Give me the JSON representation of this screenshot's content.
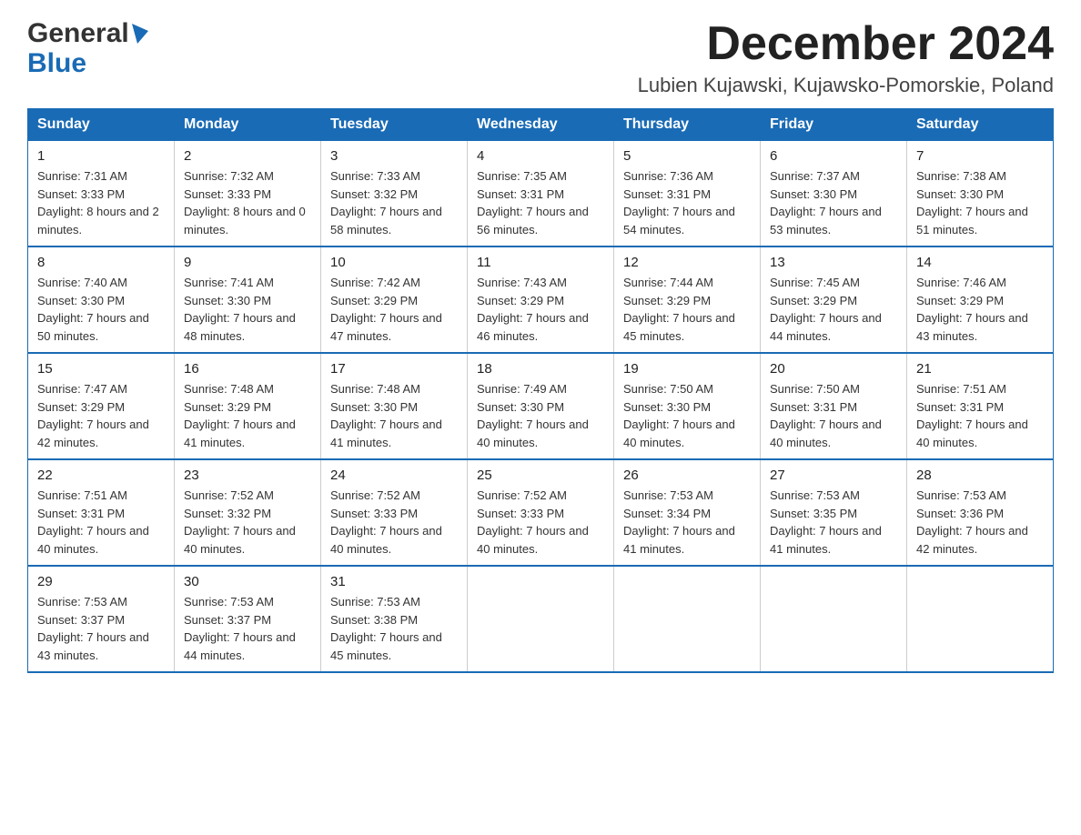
{
  "header": {
    "logo_general": "General",
    "logo_blue": "Blue",
    "month_title": "December 2024",
    "location": "Lubien Kujawski, Kujawsko-Pomorskie, Poland"
  },
  "weekdays": [
    "Sunday",
    "Monday",
    "Tuesday",
    "Wednesday",
    "Thursday",
    "Friday",
    "Saturday"
  ],
  "weeks": [
    [
      {
        "day": "1",
        "sunrise": "7:31 AM",
        "sunset": "3:33 PM",
        "daylight": "8 hours and 2 minutes."
      },
      {
        "day": "2",
        "sunrise": "7:32 AM",
        "sunset": "3:33 PM",
        "daylight": "8 hours and 0 minutes."
      },
      {
        "day": "3",
        "sunrise": "7:33 AM",
        "sunset": "3:32 PM",
        "daylight": "7 hours and 58 minutes."
      },
      {
        "day": "4",
        "sunrise": "7:35 AM",
        "sunset": "3:31 PM",
        "daylight": "7 hours and 56 minutes."
      },
      {
        "day": "5",
        "sunrise": "7:36 AM",
        "sunset": "3:31 PM",
        "daylight": "7 hours and 54 minutes."
      },
      {
        "day": "6",
        "sunrise": "7:37 AM",
        "sunset": "3:30 PM",
        "daylight": "7 hours and 53 minutes."
      },
      {
        "day": "7",
        "sunrise": "7:38 AM",
        "sunset": "3:30 PM",
        "daylight": "7 hours and 51 minutes."
      }
    ],
    [
      {
        "day": "8",
        "sunrise": "7:40 AM",
        "sunset": "3:30 PM",
        "daylight": "7 hours and 50 minutes."
      },
      {
        "day": "9",
        "sunrise": "7:41 AM",
        "sunset": "3:30 PM",
        "daylight": "7 hours and 48 minutes."
      },
      {
        "day": "10",
        "sunrise": "7:42 AM",
        "sunset": "3:29 PM",
        "daylight": "7 hours and 47 minutes."
      },
      {
        "day": "11",
        "sunrise": "7:43 AM",
        "sunset": "3:29 PM",
        "daylight": "7 hours and 46 minutes."
      },
      {
        "day": "12",
        "sunrise": "7:44 AM",
        "sunset": "3:29 PM",
        "daylight": "7 hours and 45 minutes."
      },
      {
        "day": "13",
        "sunrise": "7:45 AM",
        "sunset": "3:29 PM",
        "daylight": "7 hours and 44 minutes."
      },
      {
        "day": "14",
        "sunrise": "7:46 AM",
        "sunset": "3:29 PM",
        "daylight": "7 hours and 43 minutes."
      }
    ],
    [
      {
        "day": "15",
        "sunrise": "7:47 AM",
        "sunset": "3:29 PM",
        "daylight": "7 hours and 42 minutes."
      },
      {
        "day": "16",
        "sunrise": "7:48 AM",
        "sunset": "3:29 PM",
        "daylight": "7 hours and 41 minutes."
      },
      {
        "day": "17",
        "sunrise": "7:48 AM",
        "sunset": "3:30 PM",
        "daylight": "7 hours and 41 minutes."
      },
      {
        "day": "18",
        "sunrise": "7:49 AM",
        "sunset": "3:30 PM",
        "daylight": "7 hours and 40 minutes."
      },
      {
        "day": "19",
        "sunrise": "7:50 AM",
        "sunset": "3:30 PM",
        "daylight": "7 hours and 40 minutes."
      },
      {
        "day": "20",
        "sunrise": "7:50 AM",
        "sunset": "3:31 PM",
        "daylight": "7 hours and 40 minutes."
      },
      {
        "day": "21",
        "sunrise": "7:51 AM",
        "sunset": "3:31 PM",
        "daylight": "7 hours and 40 minutes."
      }
    ],
    [
      {
        "day": "22",
        "sunrise": "7:51 AM",
        "sunset": "3:31 PM",
        "daylight": "7 hours and 40 minutes."
      },
      {
        "day": "23",
        "sunrise": "7:52 AM",
        "sunset": "3:32 PM",
        "daylight": "7 hours and 40 minutes."
      },
      {
        "day": "24",
        "sunrise": "7:52 AM",
        "sunset": "3:33 PM",
        "daylight": "7 hours and 40 minutes."
      },
      {
        "day": "25",
        "sunrise": "7:52 AM",
        "sunset": "3:33 PM",
        "daylight": "7 hours and 40 minutes."
      },
      {
        "day": "26",
        "sunrise": "7:53 AM",
        "sunset": "3:34 PM",
        "daylight": "7 hours and 41 minutes."
      },
      {
        "day": "27",
        "sunrise": "7:53 AM",
        "sunset": "3:35 PM",
        "daylight": "7 hours and 41 minutes."
      },
      {
        "day": "28",
        "sunrise": "7:53 AM",
        "sunset": "3:36 PM",
        "daylight": "7 hours and 42 minutes."
      }
    ],
    [
      {
        "day": "29",
        "sunrise": "7:53 AM",
        "sunset": "3:37 PM",
        "daylight": "7 hours and 43 minutes."
      },
      {
        "day": "30",
        "sunrise": "7:53 AM",
        "sunset": "3:37 PM",
        "daylight": "7 hours and 44 minutes."
      },
      {
        "day": "31",
        "sunrise": "7:53 AM",
        "sunset": "3:38 PM",
        "daylight": "7 hours and 45 minutes."
      },
      null,
      null,
      null,
      null
    ]
  ]
}
